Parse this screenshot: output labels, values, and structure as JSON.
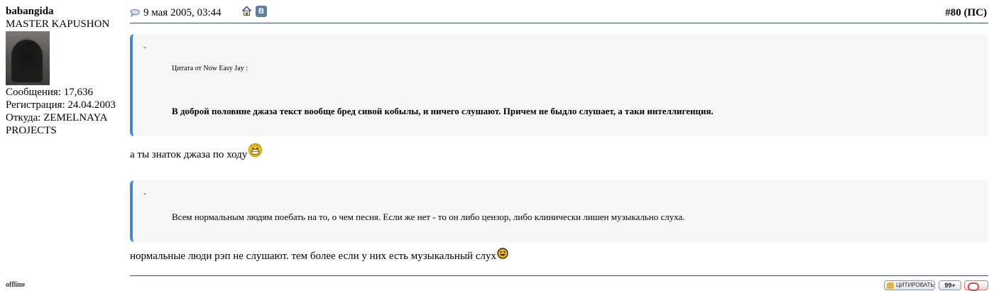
{
  "user": {
    "name": "babangida",
    "title": "MASTER KAPUSHON",
    "messages": "Сообщения: 17,636",
    "registration": "Регистрация: 24.04.2003",
    "location_label": "Откуда: ZEMELNAYA",
    "location_label2": "PROJECTS",
    "status": "offline"
  },
  "post": {
    "date": "9 мая 2005, 03:44",
    "number": "#80",
    "number_suffix": "(ПС)",
    "vk_label": "В"
  },
  "quotes": [
    {
      "dash": "-",
      "author": "Цитата от Now Easy Jay :",
      "text": "В доброй половине джаза текст вообще бред сивой кобылы, и ничего слушают. Причем не быдло слушает, а таки интеллигенция."
    },
    {
      "dash": "-",
      "text": "Всем нормальным людям поебать на то, о чем песня. Если же нет - то он либо цензор, либо клинически лишен музыкально слуха."
    }
  ],
  "replies": [
    "а ты знаток джаза по ходу",
    "нормальные люди рэп не слушают. тем более если у них есть музыкальный слух"
  ],
  "footer": {
    "quote_button": "ЦИТИРОВАТЬ",
    "multiquote_button": "99+"
  },
  "colors": {
    "quote_border": "#4a86c8",
    "quote_bg": "#f6f6f6",
    "rule": "#3a4a5e"
  },
  "icons": [
    "post-icon",
    "home-icon",
    "vk-icon",
    "laughing-smiley-icon",
    "grin-smiley-icon"
  ]
}
